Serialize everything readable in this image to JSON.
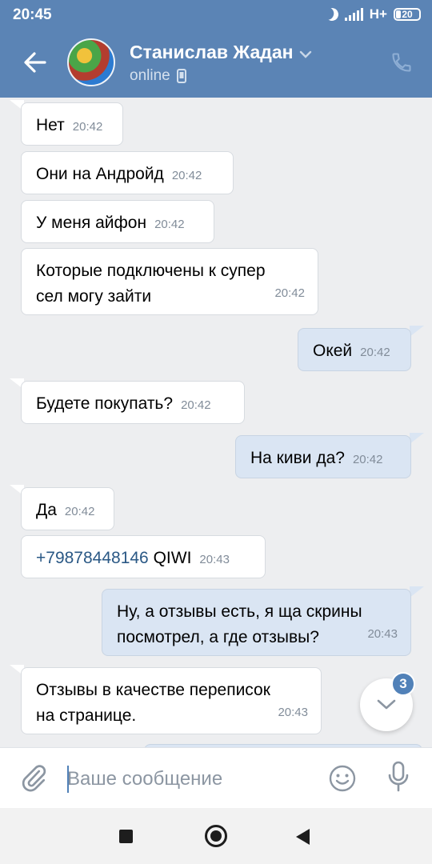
{
  "status_bar": {
    "time": "20:45",
    "network": "H+",
    "battery": "20"
  },
  "header": {
    "name": "Станислав Жадан",
    "status": "online",
    "icons": [
      "back-arrow-icon",
      "avatar",
      "chevron-down-icon",
      "mobile-device-icon",
      "phone-icon"
    ]
  },
  "messages": [
    {
      "direction": "in",
      "text": "Нет",
      "time": "20:42"
    },
    {
      "direction": "in",
      "text": "Они на Андройд",
      "time": "20:42"
    },
    {
      "direction": "in",
      "text": "У меня айфон",
      "time": "20:42"
    },
    {
      "direction": "in",
      "text": "Которые подключены к супер сел могу зайти",
      "line1": "Которые подключены к супер",
      "line2": "сел могу зайти",
      "time": "20:42"
    },
    {
      "direction": "out",
      "text": "Окей",
      "time": "20:42"
    },
    {
      "direction": "in",
      "text": "Будете покупать?",
      "time": "20:42"
    },
    {
      "direction": "out",
      "text": "На киви да?",
      "time": "20:42"
    },
    {
      "direction": "in",
      "text": "Да",
      "time": "20:42"
    },
    {
      "direction": "in",
      "link": "+79878448146",
      "text": "QIWI",
      "time": "20:43"
    },
    {
      "direction": "out",
      "text": "Ну, а отзывы есть, я ща скрины посмотрел, а где отзывы?",
      "line1": "Ну, а отзывы есть, я ща скрины",
      "line2": "посмотрел, а где отзывы?",
      "time": "20:43"
    },
    {
      "direction": "in",
      "text": "Отзывы в качестве переписок на странице.",
      "line1": "Отзывы в качестве переписок",
      "line2": "на странице.",
      "time": "20:43"
    }
  ],
  "scroll_down": {
    "badge": "3"
  },
  "composer": {
    "placeholder": "Ваше сообщение",
    "value": ""
  },
  "colors": {
    "header": "#5b84b5",
    "background": "#edeef0",
    "incoming_bubble": "#ffffff",
    "outgoing_bubble": "#dae5f3",
    "link": "#2a5885",
    "accent": "#5181b8"
  }
}
